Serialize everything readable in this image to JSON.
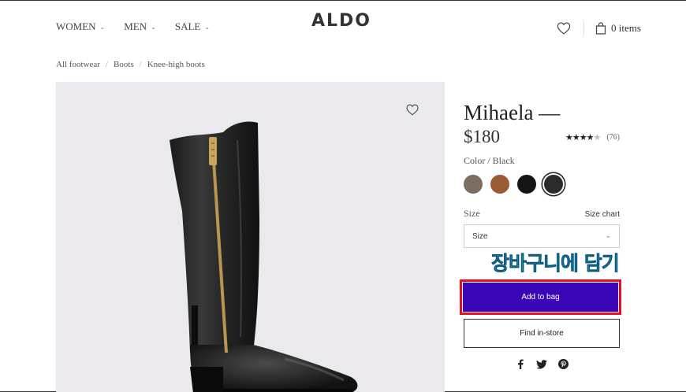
{
  "header": {
    "nav": [
      {
        "label": "WOMEN"
      },
      {
        "label": "MEN"
      },
      {
        "label": "SALE"
      }
    ],
    "logo": "ALDO",
    "cart_label": "0 items",
    "icons": {
      "wishlist": "heart-icon",
      "bag": "shopping-bag-icon",
      "dropdown": "chevron-down-icon"
    }
  },
  "breadcrumb": [
    {
      "label": "All footwear"
    },
    {
      "label": "Boots"
    },
    {
      "label": "Knee-high boots"
    }
  ],
  "product": {
    "name": "Mihaela —",
    "price": "$180",
    "rating": {
      "value": 4,
      "max": 5,
      "reviews": "(76)"
    },
    "color_label": "Color / Black",
    "swatches": [
      {
        "name": "taupe",
        "color": "#7c6e62"
      },
      {
        "name": "cognac",
        "color": "#9a5a34"
      },
      {
        "name": "black",
        "color": "#151515"
      },
      {
        "name": "black-selected",
        "color": "#2b2b2b",
        "selected": true
      }
    ],
    "size_label": "Size",
    "size_chart_label": "Size chart",
    "size_select_value": "Size",
    "add_to_bag_label": "Add to bag",
    "find_in_store_label": "Find in-store",
    "social": [
      "facebook-icon",
      "twitter-icon",
      "pinterest-icon"
    ]
  },
  "annotation": "장바구니에 담기",
  "colors": {
    "accent": "#3a06b8",
    "highlight_border": "#e8101e",
    "annotation_text": "#2aa3d8",
    "image_bg": "#ebe9ee"
  }
}
